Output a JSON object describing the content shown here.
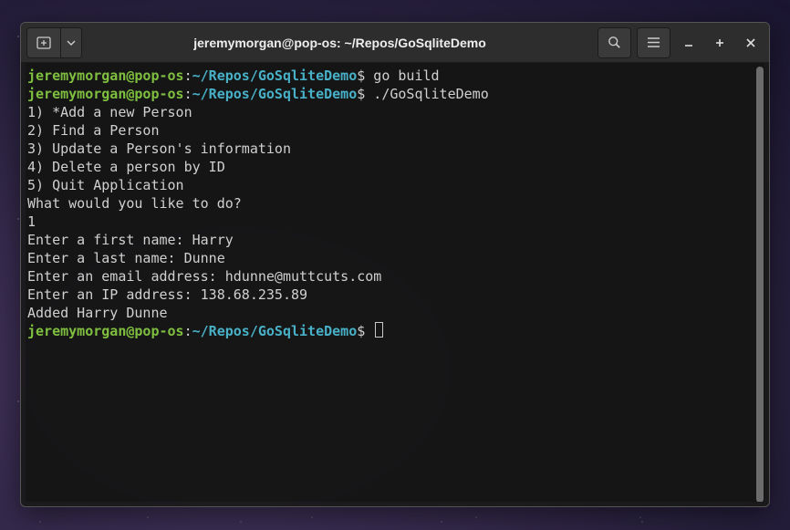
{
  "window": {
    "title": "jeremymorgan@pop-os: ~/Repos/GoSqliteDemo"
  },
  "prompt": {
    "user_host": "jeremymorgan@pop-os",
    "separator": ":",
    "path": "~/Repos/GoSqliteDemo",
    "symbol": "$"
  },
  "session": {
    "cmd1": " go build",
    "cmd2": " ./GoSqliteDemo",
    "menu1": "1) *Add a new Person",
    "menu2": "2) Find a Person",
    "menu3": "3) Update a Person's information",
    "menu4": "4) Delete a person by ID",
    "menu5": "5) Quit Application",
    "prompt_q": "What would you like to do?",
    "input_choice": "1",
    "fn_prompt": "Enter a first name: Harry",
    "ln_prompt": "Enter a last name: Dunne",
    "em_prompt": "Enter an email address: hdunne@muttcuts.com",
    "ip_prompt": "Enter an IP address: 138.68.235.89",
    "added": "Added Harry Dunne"
  }
}
